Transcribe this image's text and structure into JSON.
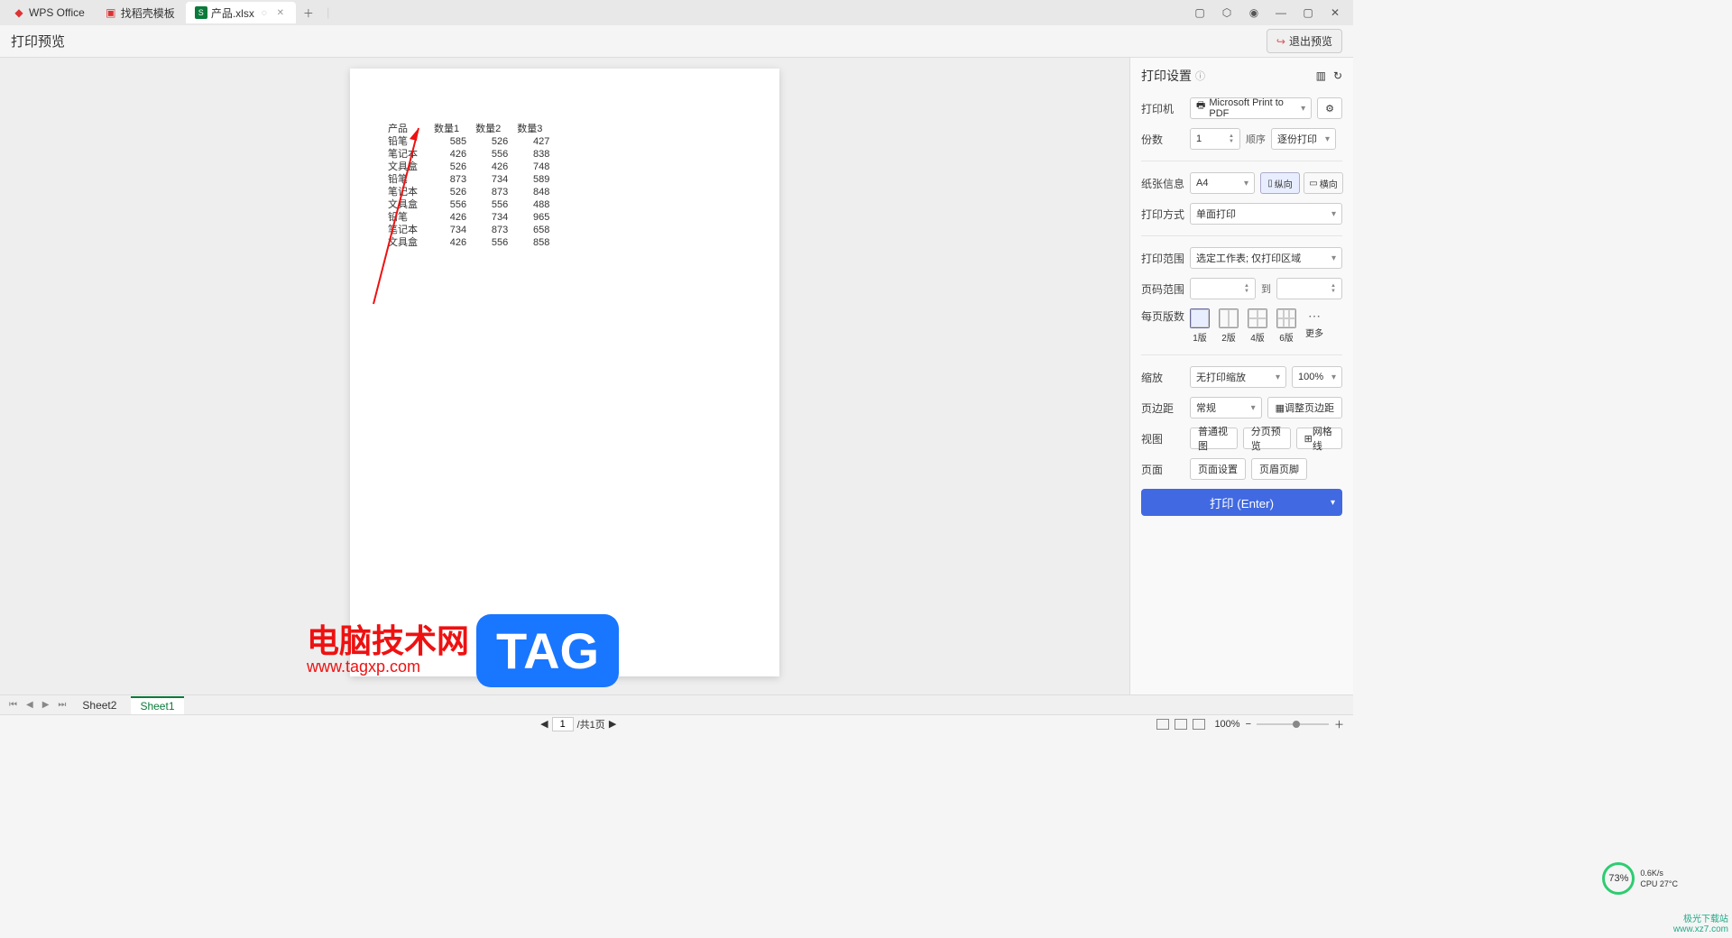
{
  "tabs": {
    "home": "WPS Office",
    "template": "找稻壳模板",
    "active": "产品.xlsx"
  },
  "header": {
    "title": "打印预览",
    "exit": "退出预览"
  },
  "chart_data": {
    "type": "table",
    "columns": [
      "产品",
      "数量1",
      "数量2",
      "数量3"
    ],
    "rows": [
      [
        "铅笔",
        585,
        526,
        427
      ],
      [
        "笔记本",
        426,
        556,
        838
      ],
      [
        "文具盒",
        526,
        426,
        748
      ],
      [
        "铅笔",
        873,
        734,
        589
      ],
      [
        "笔记本",
        526,
        873,
        848
      ],
      [
        "文具盒",
        556,
        556,
        488
      ],
      [
        "铅笔",
        426,
        734,
        965
      ],
      [
        "笔记本",
        734,
        873,
        658
      ],
      [
        "文具盒",
        426,
        556,
        858
      ]
    ]
  },
  "panel": {
    "title": "打印设置",
    "printer_label": "打印机",
    "printer_value": "Microsoft Print to PDF",
    "copies_label": "份数",
    "copies_value": "1",
    "order_label": "顺序",
    "order_value": "逐份打印",
    "paper_label": "纸张信息",
    "paper_value": "A4",
    "portrait": "纵向",
    "landscape": "横向",
    "print_method_label": "打印方式",
    "print_method_value": "单面打印",
    "range_label": "打印范围",
    "range_value": "选定工作表; 仅打印区域",
    "page_range_label": "页码范围",
    "to": "到",
    "per_page_label": "每页版数",
    "layouts": [
      "1版",
      "2版",
      "4版",
      "6版"
    ],
    "more": "更多",
    "zoom_label": "缩放",
    "zoom_value": "无打印缩放",
    "zoom_pct": "100%",
    "margin_label": "页边距",
    "margin_value": "常规",
    "margin_adjust": "调整页边距",
    "view_label": "视图",
    "view_normal": "普通视图",
    "view_split": "分页预览",
    "gridlines": "网格线",
    "page_label": "页面",
    "page_setup": "页面设置",
    "header_footer": "页眉页脚",
    "print_btn": "打印 (Enter)"
  },
  "sheets": {
    "s2": "Sheet2",
    "s1": "Sheet1"
  },
  "footer": {
    "page_current": "1",
    "page_total": "/共1页",
    "zoom": "100%"
  },
  "watermark": {
    "text": "电脑技术网",
    "url": "www.tagxp.com",
    "tag": "TAG"
  },
  "cpu": {
    "pct": "73%",
    "net": "0.6K/s",
    "temp": "CPU 27°C"
  },
  "site": {
    "name": "极光下载站",
    "url": "www.xz7.com"
  }
}
